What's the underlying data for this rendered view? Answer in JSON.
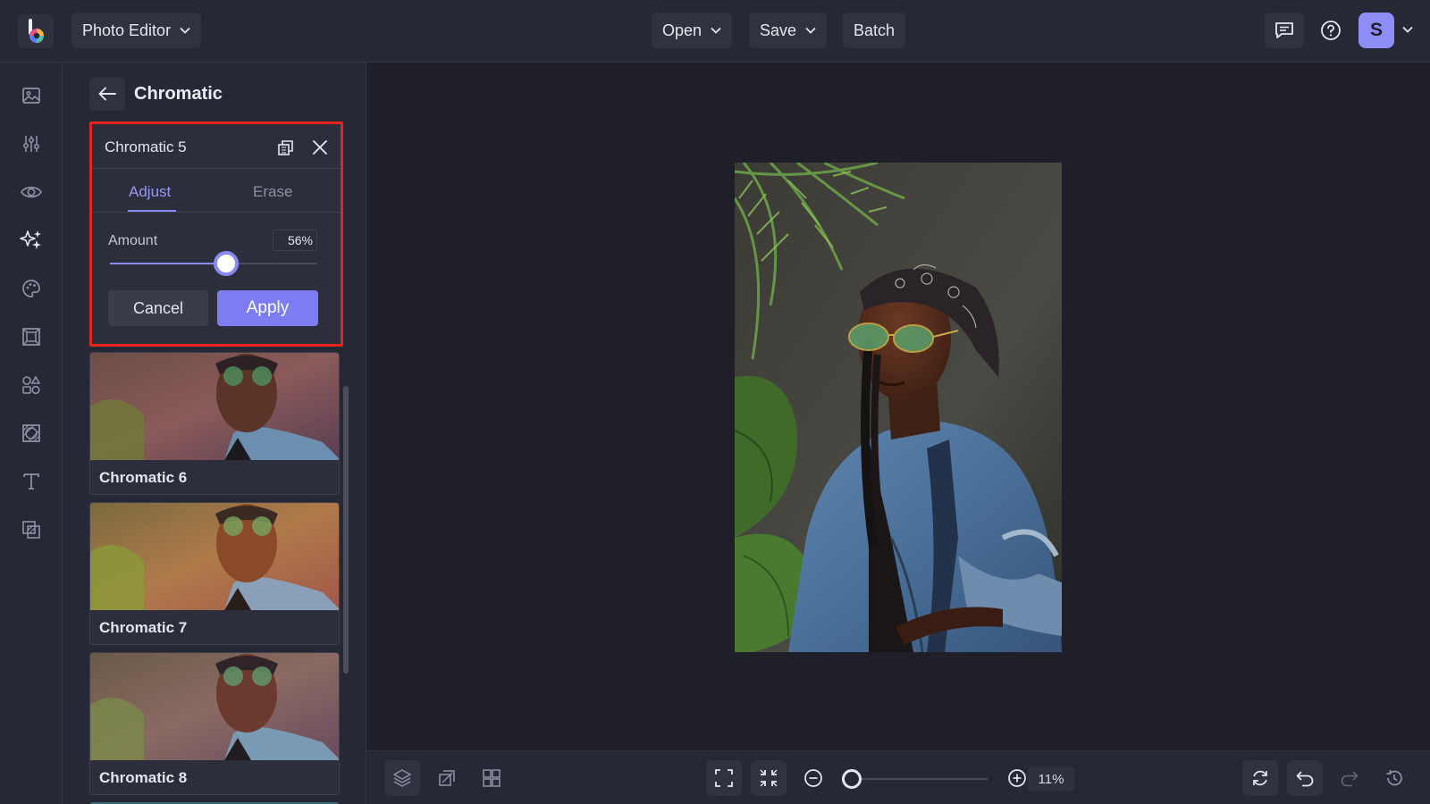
{
  "topbar": {
    "app_menu_label": "Photo Editor",
    "open_label": "Open",
    "save_label": "Save",
    "batch_label": "Batch",
    "avatar_initial": "S"
  },
  "rail": {
    "items": [
      {
        "icon": "image-icon"
      },
      {
        "icon": "sliders-icon"
      },
      {
        "icon": "eye-icon"
      },
      {
        "icon": "sparkles-icon",
        "active": true
      },
      {
        "icon": "palette-icon"
      },
      {
        "icon": "frame-icon"
      },
      {
        "icon": "shapes-icon"
      },
      {
        "icon": "texture-icon"
      },
      {
        "icon": "text-icon"
      },
      {
        "icon": "overlay-icon"
      }
    ]
  },
  "panel": {
    "title": "Chromatic",
    "card": {
      "title": "Chromatic 5",
      "tabs": [
        {
          "label": "Adjust",
          "active": true
        },
        {
          "label": "Erase",
          "active": false
        }
      ],
      "amount_label": "Amount",
      "amount_value": "56%",
      "amount_fraction": 0.56,
      "cancel_label": "Cancel",
      "apply_label": "Apply"
    },
    "presets": [
      {
        "label": "Chromatic 6"
      },
      {
        "label": "Chromatic 7"
      },
      {
        "label": "Chromatic 8"
      }
    ]
  },
  "bottombar": {
    "zoom_value": "11%",
    "zoom_fraction": 0.05
  },
  "colors": {
    "accent": "#8a88f2",
    "apply": "#7e7cf2",
    "highlight_border": "#e5251b",
    "background": "#1e1f28",
    "panel": "#262835"
  }
}
